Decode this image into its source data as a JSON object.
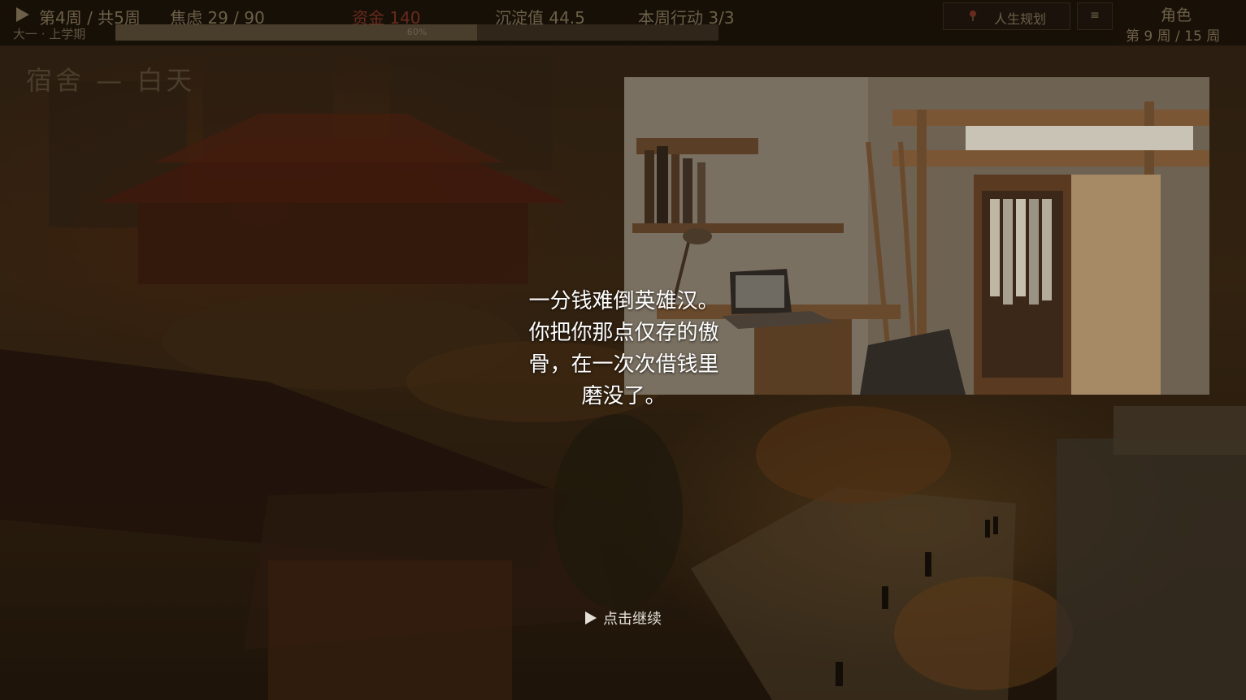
{
  "hud": {
    "week": "第4周 / 共5周",
    "anxiety": "焦虑 29 / 90",
    "money": "资金 140",
    "deposit": "沉淀值 44.5",
    "actions": "本周行动 3/3",
    "term": "大一 · 上学期",
    "progress_percent": 60,
    "progress_text": "60%"
  },
  "buttons": {
    "life_plan": "人生规划",
    "menu": "≡",
    "role": "角色"
  },
  "week_counter": "第 9 周 / 15 周",
  "scene": {
    "title": "宿舍 — 白天"
  },
  "narration": {
    "lines": [
      "一分钱难倒英雄汉。",
      "你把你那点仅存的傲",
      "骨，在一次次借钱里",
      "磨没了。"
    ]
  },
  "continue": {
    "label": "点击继续"
  },
  "icons": {
    "play": "play-icon",
    "pin": "pin-icon",
    "menu": "hamburger-icon"
  },
  "colors": {
    "hud_text": "#6d6048",
    "money": "#6a2a1e",
    "narration": "#ffffff"
  }
}
